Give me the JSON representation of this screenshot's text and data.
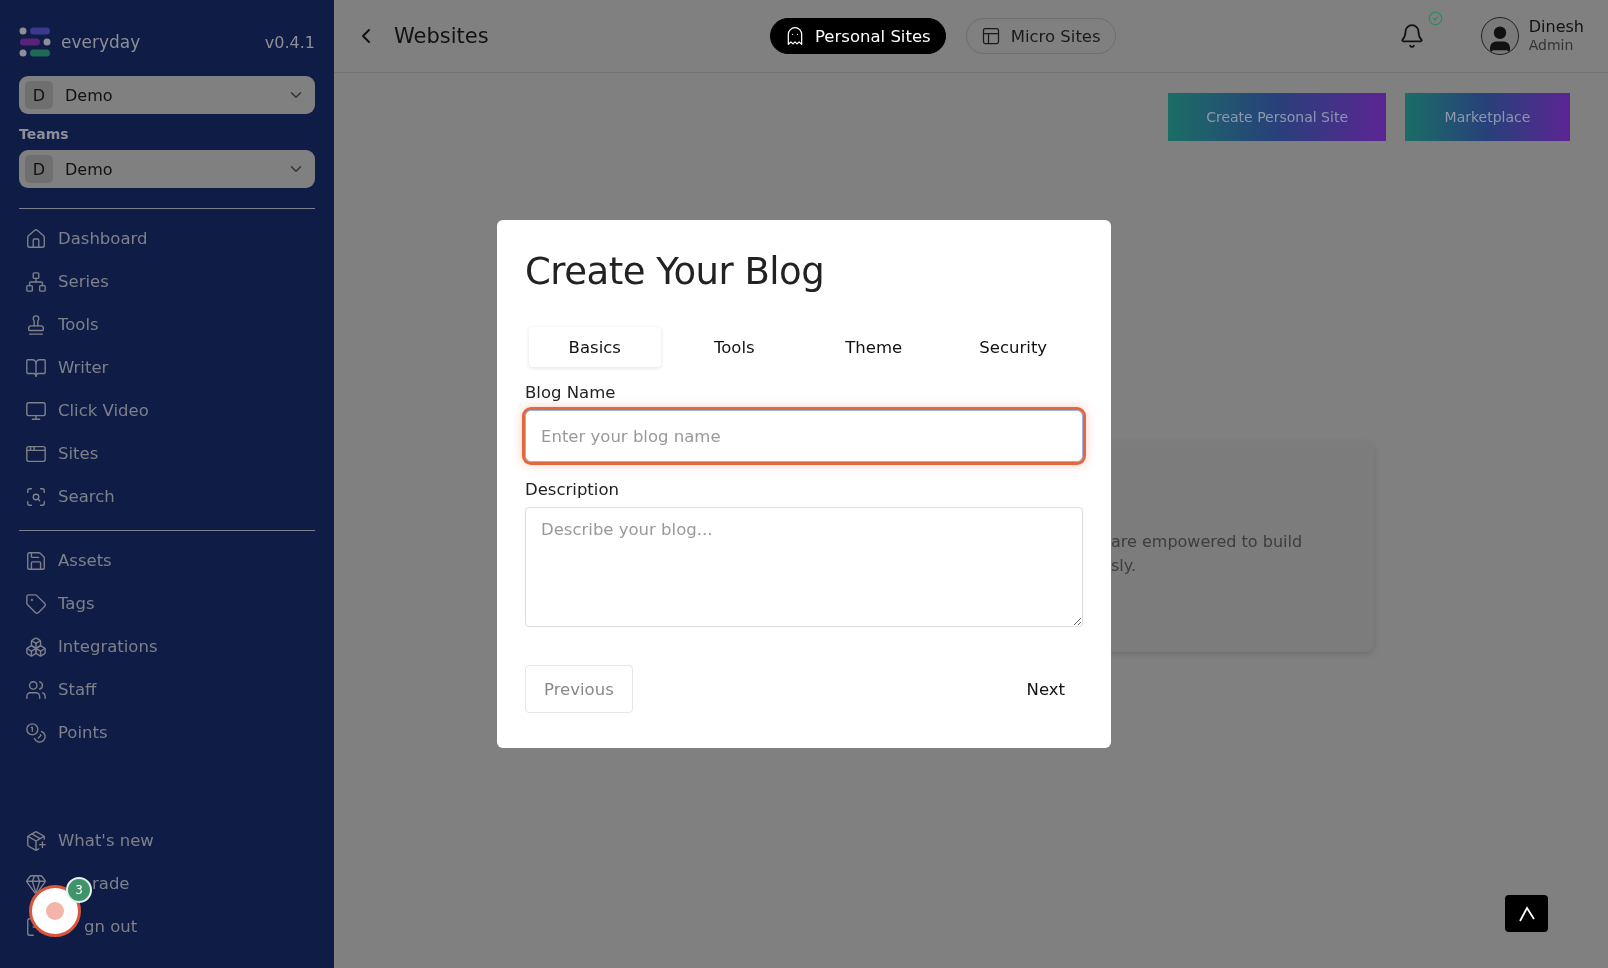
{
  "sidebar": {
    "brand": "everyday",
    "version": "v0.4.1",
    "workspace": {
      "initial": "D",
      "name": "Demo"
    },
    "teams_label": "Teams",
    "team": {
      "initial": "D",
      "name": "Demo"
    },
    "nav_main": [
      "Dashboard",
      "Series",
      "Tools",
      "Writer",
      "Click Video",
      "Sites",
      "Search"
    ],
    "nav_secondary": [
      "Assets",
      "Tags",
      "Integrations",
      "Staff",
      "Points"
    ],
    "nav_footer": [
      "What's new",
      "rade",
      "gn out"
    ]
  },
  "header": {
    "title": "Websites",
    "tabs": [
      {
        "label": "Personal Sites",
        "selected": true
      },
      {
        "label": "Micro Sites",
        "selected": false
      }
    ],
    "notifications_ok": true,
    "user": {
      "name": "Dinesh",
      "role": "Admin"
    }
  },
  "actions": [
    "Create Personal Site",
    "Marketplace"
  ],
  "background_card": {
    "lines": [
      "are empowered to build",
      "sly."
    ]
  },
  "modal": {
    "title": "Create Your Blog",
    "tabs": [
      {
        "label": "Basics",
        "selected": true
      },
      {
        "label": "Tools",
        "selected": false
      },
      {
        "label": "Theme",
        "selected": false
      },
      {
        "label": "Security",
        "selected": false
      }
    ],
    "fields": [
      {
        "kind": "input",
        "label": "Blog Name",
        "placeholder": "Enter your blog name",
        "focused": true
      },
      {
        "kind": "textarea",
        "label": "Description",
        "placeholder": "Describe your blog...",
        "focused": false
      }
    ],
    "previous": {
      "label": "Previous",
      "disabled": true
    },
    "next": {
      "label": "Next"
    }
  },
  "chat_bubble": {
    "badge": "3"
  }
}
